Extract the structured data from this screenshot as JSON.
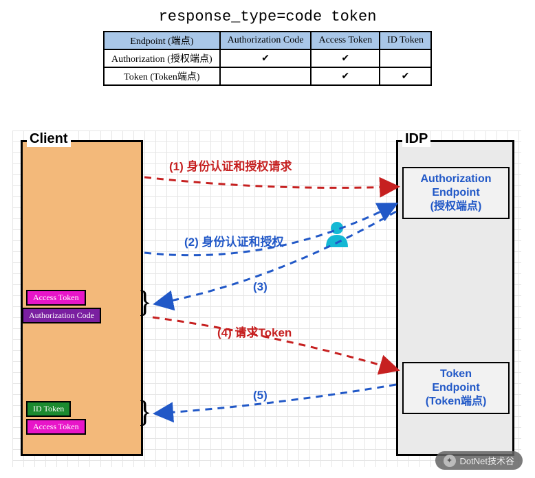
{
  "title": "response_type=code token",
  "table": {
    "headers": [
      "Endpoint (端点)",
      "Authorization Code",
      "Access Token",
      "ID Token"
    ],
    "rows": [
      {
        "label": "Authorization (授权端点)",
        "cells": [
          "✔",
          "✔",
          ""
        ]
      },
      {
        "label": "Token (Token端点)",
        "cells": [
          "",
          "✔",
          "✔"
        ]
      }
    ]
  },
  "client": {
    "title": "Client"
  },
  "idp": {
    "title": "IDP",
    "auth": {
      "line1": "Authorization",
      "line2": "Endpoint",
      "line3": "(授权端点)"
    },
    "token": {
      "line1": "Token",
      "line2": "Endpoint",
      "line3": "(Token端点)"
    }
  },
  "chips": {
    "access1": "Access Token",
    "authcode": "Authorization Code",
    "id": "ID Token",
    "access2": "Access Token"
  },
  "steps": {
    "s1": "(1) 身份认证和授权请求",
    "s2": "(2) 身份认证和授权",
    "s3": "(3)",
    "s4": "(4) 请求Token",
    "s5": "(5)"
  },
  "watermark": "DotNet技术谷"
}
